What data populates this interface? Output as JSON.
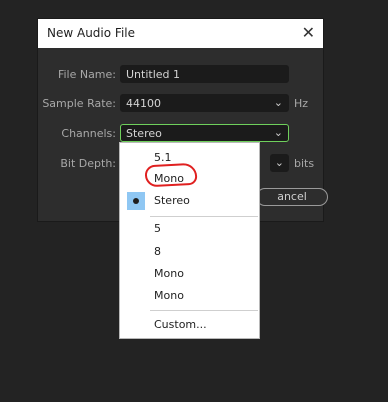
{
  "dialog": {
    "title": "New Audio File",
    "close_glyph": "✕",
    "fields": {
      "file_name": {
        "label": "File Name:",
        "value": "Untitled 1"
      },
      "sample_rate": {
        "label": "Sample Rate:",
        "value": "44100",
        "unit": "Hz"
      },
      "channels": {
        "label": "Channels:",
        "value": "Stereo"
      },
      "bit_depth": {
        "label": "Bit Depth:",
        "unit": "bits"
      }
    },
    "cancel_visible_text": "ancel"
  },
  "channels_dropdown": {
    "items": [
      {
        "label": "5.1",
        "selected": false
      },
      {
        "label": "Mono",
        "selected": false
      },
      {
        "label": "Stereo",
        "selected": true
      },
      {
        "label": "5",
        "selected": false
      },
      {
        "label": "8",
        "selected": false
      },
      {
        "label": "Mono",
        "selected": false
      },
      {
        "label": "Mono",
        "selected": false
      },
      {
        "label": "Custom...",
        "selected": false
      }
    ],
    "selected_indicator_color": "#8fc7f3"
  },
  "annotation": {
    "color": "#e02020",
    "shape": "hand-drawn-ellipse",
    "target": "Mono"
  },
  "icons": {
    "chevron": "chevron-down-icon",
    "close": "close-icon"
  },
  "chevron_glyph": "⌄"
}
